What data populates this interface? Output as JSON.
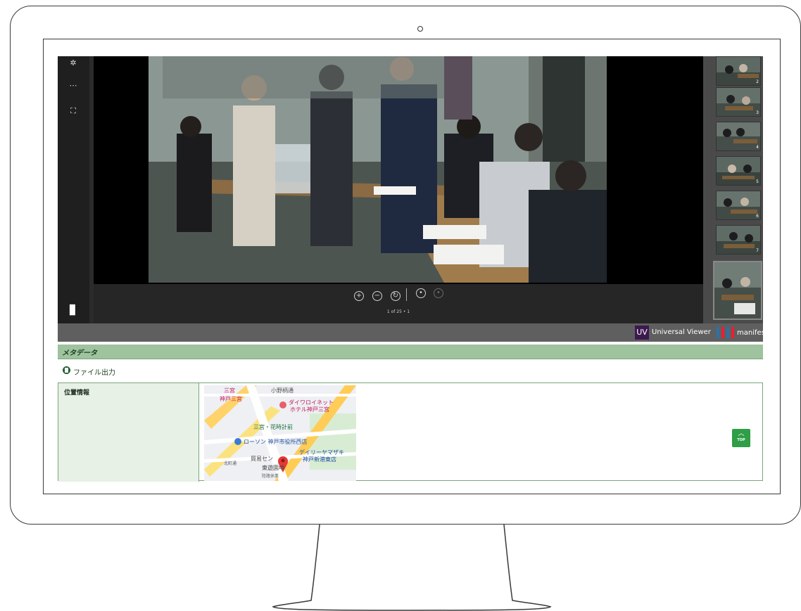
{
  "viewer": {
    "page_counter": "1 of 25 • 1",
    "thumbnail_numbers": [
      "2",
      "3",
      "4",
      "5",
      "6",
      "7",
      ""
    ],
    "uv_logo_text": "UV",
    "uv_label": "Universal Viewer",
    "manifest_label": "manifest"
  },
  "metadata": {
    "section_title": "メタデータ",
    "file_output_label": "ファイル出力",
    "location_label": "位置情報"
  },
  "map": {
    "labels": [
      "三宮",
      "神戸三宮",
      "小野柄通",
      "ダイワロイネット",
      "ホテル神戸三宮",
      "三宮・花時計前",
      "ローソン 神戸市役所西店",
      "デイリーヤマザキ",
      "神戸新港東店",
      "貿易セン",
      "北町通",
      "東遊園地",
      "陸路休業"
    ]
  },
  "top_button": {
    "label": "TOP"
  },
  "colors": {
    "metadata_header": "#9ec39e",
    "label_cell": "#e8f1e6",
    "top_button": "#2f9e46",
    "uv_logo": "#3c1a4f"
  }
}
